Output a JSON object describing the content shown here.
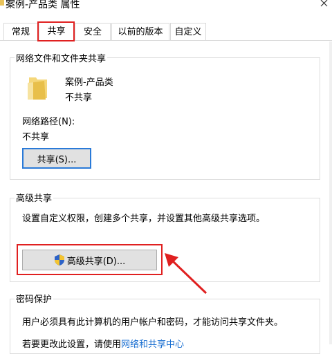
{
  "window": {
    "title": "案例-产品类 属性"
  },
  "tabs": [
    {
      "label": "常规"
    },
    {
      "label": "共享"
    },
    {
      "label": "安全"
    },
    {
      "label": "以前的版本"
    },
    {
      "label": "自定义"
    }
  ],
  "network_share": {
    "group_label": "网络文件和文件夹共享",
    "folder_name": "案例-产品类",
    "share_status": "不共享",
    "path_label": "网络路径(N):",
    "path_value": "不共享",
    "share_button": "共享(S)..."
  },
  "advanced_share": {
    "group_label": "高级共享",
    "description": "设置自定义权限，创建多个共享，并设置其他高级共享选项。",
    "button": "高级共享(D)..."
  },
  "password_protection": {
    "group_label": "密码保护",
    "description": "用户必须具有此计算机的用户帐户和密码，才能访问共享文件夹。",
    "change_prefix": "若要更改此设置，请使用",
    "link_text": "网络和共享中心"
  },
  "colors": {
    "annotation_red": "#e02020",
    "link_blue": "#1a6fd1",
    "button_bg": "#e1e1e1",
    "focus_blue": "#2a7ad8"
  },
  "icons": [
    "folder-icon",
    "close-icon",
    "uac-shield-icon"
  ]
}
